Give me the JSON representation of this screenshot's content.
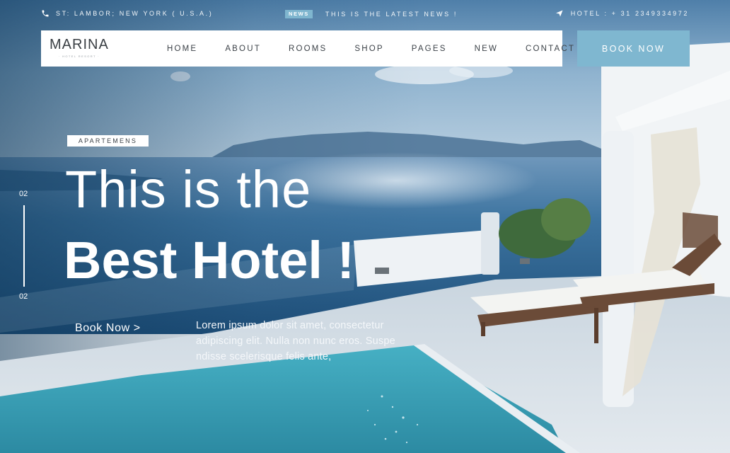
{
  "topbar": {
    "address": "ST: LAMBOR; NEW YORK ( U.S.A.)",
    "news_badge": "NEWS",
    "news_text": "THIS IS THE LATEST NEWS !",
    "phone": "HOTEL : + 31 2349334972",
    "icons": {
      "phone": "phone-icon",
      "send": "paper-plane-icon"
    }
  },
  "logo": {
    "name": "MARINA",
    "subtitle": "· HOTEL RESORT ·"
  },
  "nav": {
    "items": [
      {
        "label": "HOME"
      },
      {
        "label": "ABOUT"
      },
      {
        "label": "ROOMS"
      },
      {
        "label": "SHOP"
      },
      {
        "label": "PAGES"
      },
      {
        "label": "NEW"
      },
      {
        "label": "CONTACT"
      }
    ],
    "book_button": "BOOK NOW"
  },
  "hero": {
    "tag": "APARTEMENS",
    "title_line1": "This is the",
    "title_line2": "Best Hotel !",
    "slide_current": "02",
    "slide_total": "02",
    "book_link": "Book Now >",
    "description": "Lorem ipsum dolor sit amet, consectetur adipiscing elit. Nulla non nunc eros. Suspe ndisse scelerisque felis ante,"
  },
  "colors": {
    "accent": "#7fb7d0",
    "nav_text": "#3c4248",
    "sky": "#9fc0d8",
    "sea": "#2f6a96",
    "pool": "#3aa3b8"
  }
}
